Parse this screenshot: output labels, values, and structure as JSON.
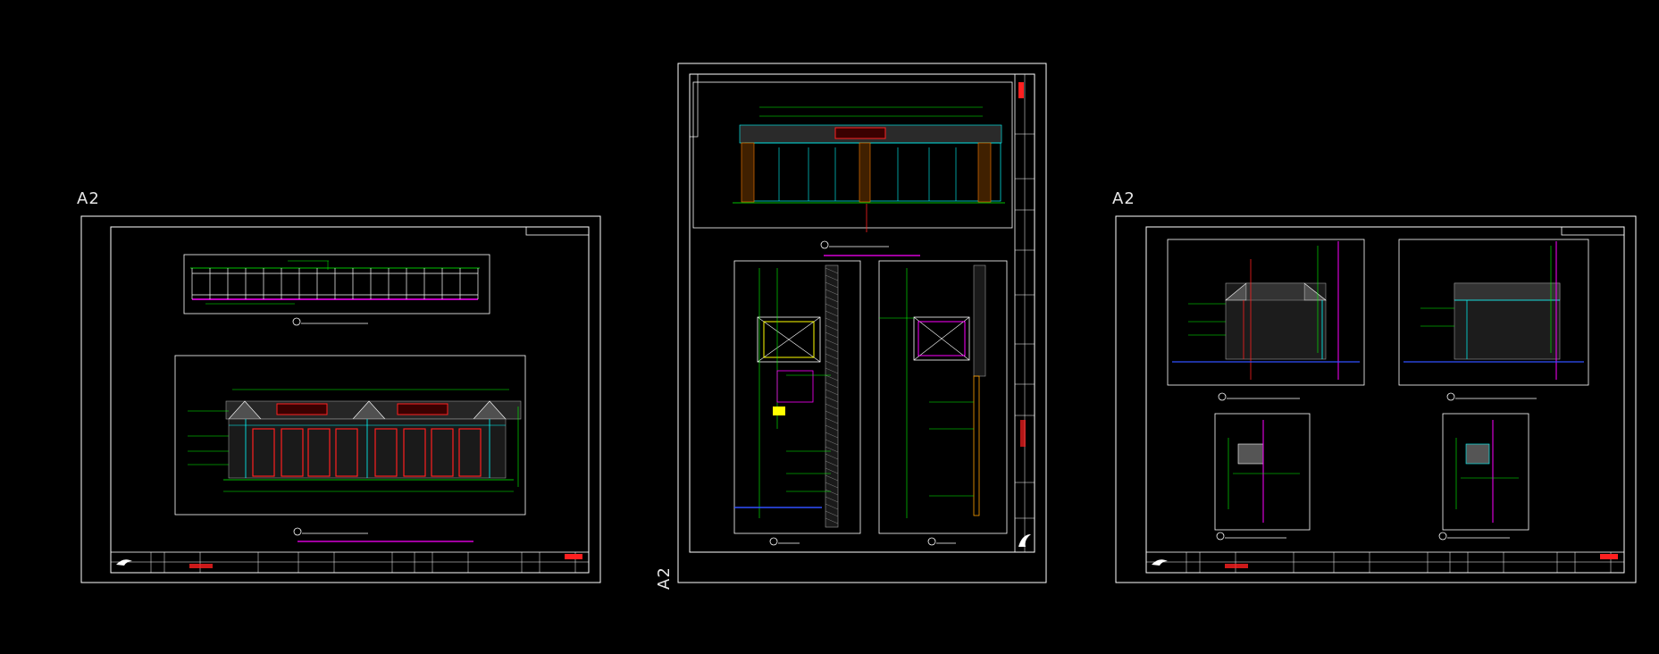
{
  "sheets": [
    {
      "id": "left",
      "size_label": "A2"
    },
    {
      "id": "middle",
      "size_label": "A2"
    },
    {
      "id": "right",
      "size_label": "A2"
    }
  ],
  "colors": {
    "background": "#000000",
    "frame": "#ffffff",
    "line_green": "#00ff00",
    "line_cyan": "#00ffff",
    "line_red": "#ff2020",
    "line_magenta": "#ff00ff",
    "line_yellow": "#ffff00",
    "line_blue": "#3050ff",
    "line_grey": "#9a9a9a"
  },
  "drawing_icons": [
    "company-logo-icon",
    "section-marker-icon"
  ]
}
